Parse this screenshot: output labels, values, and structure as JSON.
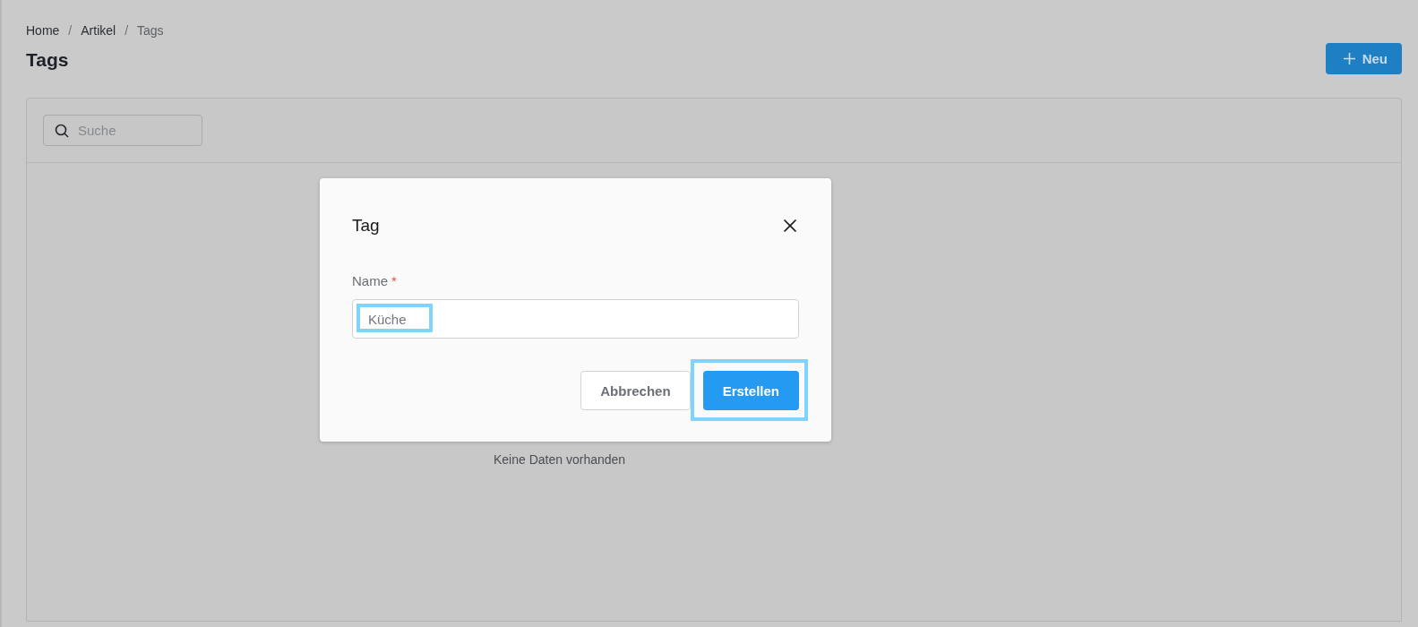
{
  "breadcrumb": {
    "separator": "/",
    "items": [
      {
        "label": "Home",
        "current": false
      },
      {
        "label": "Artikel",
        "current": false
      },
      {
        "label": "Tags",
        "current": true
      }
    ]
  },
  "page_title": "Tags",
  "new_button": {
    "label": "Neu"
  },
  "search": {
    "placeholder": "Suche"
  },
  "empty_message": "Keine Daten vorhanden",
  "dialog": {
    "title": "Tag",
    "field": {
      "label": "Name",
      "required_mark": "*",
      "placeholder": "Küche",
      "highlighted": true
    },
    "buttons": [
      {
        "label": "Abbrechen",
        "kind": "secondary",
        "highlighted": false
      },
      {
        "label": "Erstellen",
        "kind": "primary",
        "highlighted": true
      }
    ]
  }
}
